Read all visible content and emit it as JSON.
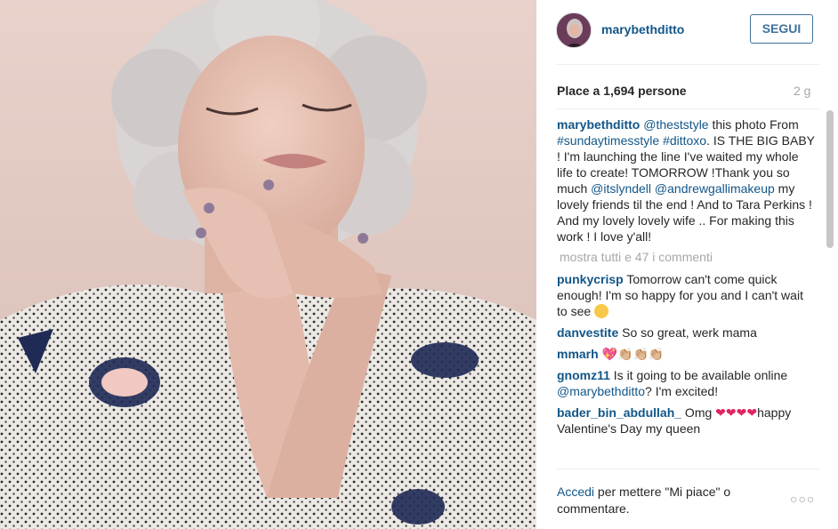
{
  "post": {
    "username": "marybethditto",
    "follow_label": "SEGUI",
    "likes_text": "Place a 1,694 persone",
    "age": "2 g",
    "caption": {
      "user": "marybethditto",
      "p1": "@theststyle",
      "p2": " this photo From ",
      "p3": "#sundaytimesstyle",
      "p4": " ",
      "p5": "#dittoxo",
      "p6": ". IS THE BIG BABY ! I'm launching the line I've waited my whole life to create! TOMORROW !Thank you so much ",
      "p7": "@itslyndell",
      "p8": " ",
      "p9": "@andrewgallimakeup",
      "p10": " my lovely friends til the end ! And to Tara Perkins ! And my lovely lovely wife .. For making this work ! I love y'all!"
    },
    "show_more": "mostra tutti e 47 i commenti",
    "comments": [
      {
        "user": "punkycrisp",
        "text": " Tomorrow can't come quick enough! I'm so happy for you and I can't wait to see "
      },
      {
        "user": "danvestite",
        "text": " So so great, werk mama"
      },
      {
        "user": "mmarh",
        "text": " 💖👏🏼👏🏼👏🏼"
      },
      {
        "user": "gnomz11",
        "text": " Is it going to be available online ",
        "mention": "@marybethditto",
        "tail": "? I'm excited!"
      },
      {
        "user": "bader_bin_abdullah_",
        "text": " Omg ",
        "hearts": "❤❤❤❤",
        "tail": "happy Valentine's Day my queen"
      }
    ],
    "footer": {
      "login": "Accedi",
      "rest": " per mettere \"Mi piace\" o commentare."
    },
    "more_icon": "more-dots-icon"
  }
}
